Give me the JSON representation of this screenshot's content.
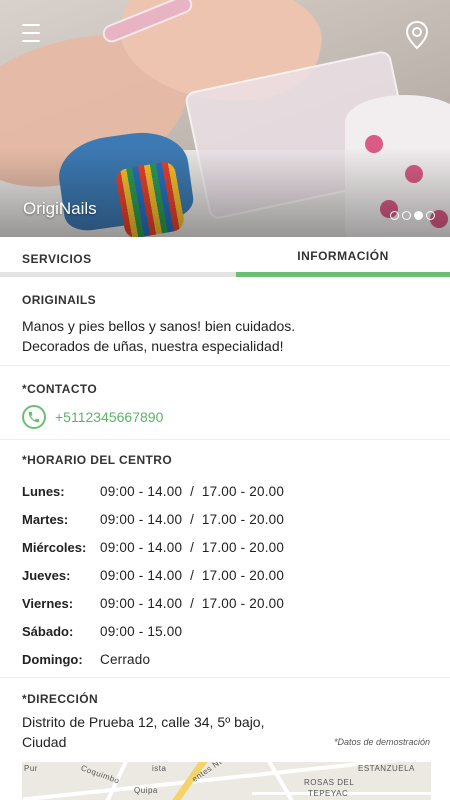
{
  "header": {
    "title": "OrigiNails",
    "slider_dots": 4,
    "slider_active": 2
  },
  "tabs": [
    {
      "label": "SERVICIOS",
      "active": false
    },
    {
      "label": "INFORMACIÓN",
      "active": true
    }
  ],
  "about": {
    "title": "ORIGINAILS",
    "line1": "Manos y pies bellos y sanos! bien cuidados.",
    "line2": "Decorados de uñas, nuestra especialidad!"
  },
  "contact": {
    "title": "*CONTACTO",
    "phone": "+5112345667890"
  },
  "hours": {
    "title": "*HORARIO DEL CENTRO",
    "rows": [
      {
        "day": "Lunes:",
        "time": "09:00 - 14.00  /  17.00 - 20.00"
      },
      {
        "day": "Martes:",
        "time": "09:00 - 14.00  /  17.00 - 20.00"
      },
      {
        "day": "Miércoles:",
        "time": "09:00 - 14.00  /  17.00 - 20.00"
      },
      {
        "day": "Jueves:",
        "time": "09:00 - 14.00  /  17.00 - 20.00"
      },
      {
        "day": "Viernes:",
        "time": "09:00 - 14.00  /  17.00 - 20.00"
      },
      {
        "day": "Sábado:",
        "time": "09:00 - 15.00"
      },
      {
        "day": "Domingo:",
        "time": "Cerrado"
      }
    ]
  },
  "address": {
    "title": "*DIRECCIÓN",
    "line1": "Distrito de Prueba 12, calle 34, 5º bajo,",
    "line2": "Ciudad",
    "demo_note": "*Datos de demostración"
  },
  "map": {
    "labels": [
      "Coquimbo",
      "Pur",
      "ista",
      "Quipa",
      "ESTANZUELA",
      "ROSAS DEL",
      "TEPEYAC",
      "entes Nt"
    ]
  },
  "colors": {
    "accent": "#6abf73",
    "tab_inactive_bar": "#e3e3e3",
    "phone_text": "#5cb467"
  },
  "icons": {
    "menu": "hamburger-icon",
    "location": "location-pin-icon",
    "phone": "phone-icon"
  }
}
